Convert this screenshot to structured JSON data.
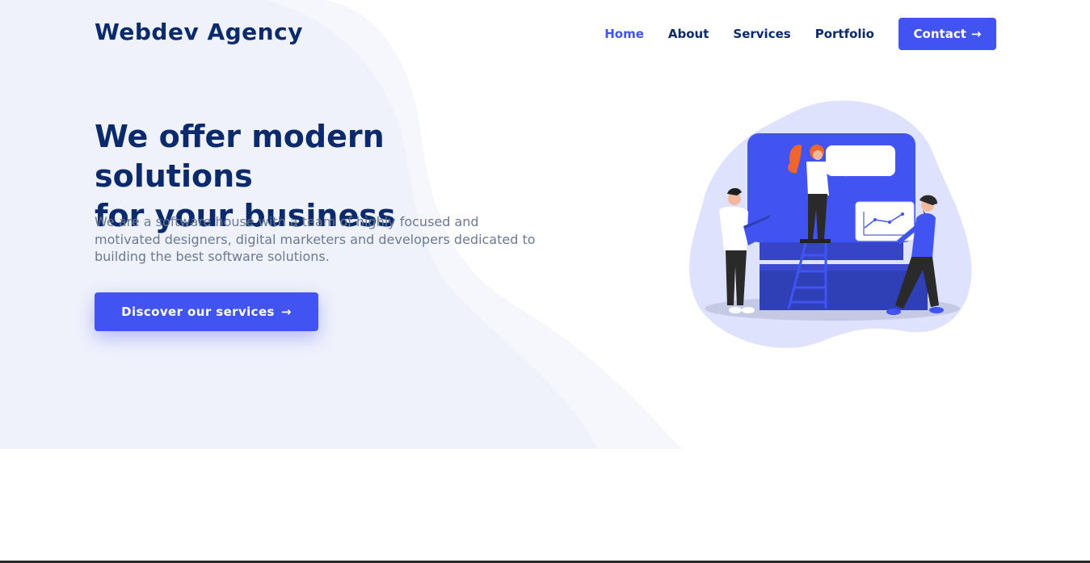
{
  "brand": {
    "name": "Webdev Agency"
  },
  "nav": {
    "items": [
      {
        "label": "Home",
        "active": true
      },
      {
        "label": "About",
        "active": false
      },
      {
        "label": "Services",
        "active": false
      },
      {
        "label": "Portfolio",
        "active": false
      }
    ],
    "contact_label": "Contact",
    "contact_icon": "arrow-right-icon"
  },
  "hero": {
    "title_line1": "We offer modern solutions",
    "title_line2": "for your business",
    "subtitle": "We are a software house with a team of highly focused and motivated designers, digital marketers and developers dedicated to building the best software solutions.",
    "cta_label": "Discover our services",
    "cta_icon": "arrow-right-icon",
    "illustration": "team-working-on-dashboard-illustration"
  },
  "colors": {
    "primary": "#4154f1",
    "heading": "#0a2a6b",
    "body_text": "#6b7a90",
    "hero_background": "#f0f3fc",
    "blob": "#dfe2fc"
  }
}
